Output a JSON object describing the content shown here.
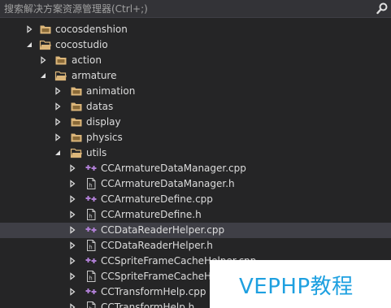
{
  "search": {
    "placeholder": "搜索解决方案资源管理器(Ctrl+;)"
  },
  "tree": {
    "items": [
      {
        "label": "cocosdenshion",
        "type": "folder",
        "level": 2,
        "expanded": false
      },
      {
        "label": "cocostudio",
        "type": "folder",
        "level": 2,
        "expanded": true
      },
      {
        "label": "action",
        "type": "folder",
        "level": 3,
        "expanded": false
      },
      {
        "label": "armature",
        "type": "folder",
        "level": 3,
        "expanded": true
      },
      {
        "label": "animation",
        "type": "folder",
        "level": 4,
        "expanded": false
      },
      {
        "label": "datas",
        "type": "folder",
        "level": 4,
        "expanded": false
      },
      {
        "label": "display",
        "type": "folder",
        "level": 4,
        "expanded": false
      },
      {
        "label": "physics",
        "type": "folder",
        "level": 4,
        "expanded": false
      },
      {
        "label": "utils",
        "type": "folder",
        "level": 4,
        "expanded": true
      },
      {
        "label": "CCArmatureDataManager.cpp",
        "type": "cpp",
        "level": 5,
        "expanded": false
      },
      {
        "label": "CCArmatureDataManager.h",
        "type": "h",
        "level": 5,
        "expanded": false
      },
      {
        "label": "CCArmatureDefine.cpp",
        "type": "cpp",
        "level": 5,
        "expanded": false
      },
      {
        "label": "CCArmatureDefine.h",
        "type": "h",
        "level": 5,
        "expanded": false
      },
      {
        "label": "CCDataReaderHelper.cpp",
        "type": "cpp",
        "level": 5,
        "expanded": false,
        "selected": true
      },
      {
        "label": "CCDataReaderHelper.h",
        "type": "h",
        "level": 5,
        "expanded": false
      },
      {
        "label": "CCSpriteFrameCacheHelper.cpp",
        "type": "cpp",
        "level": 5,
        "expanded": false
      },
      {
        "label": "CCSpriteFrameCacheHelper.h",
        "type": "h",
        "level": 5,
        "expanded": false
      },
      {
        "label": "CCTransformHelp.cpp",
        "type": "cpp",
        "level": 5,
        "expanded": false
      },
      {
        "label": "CCTransformHelp.h",
        "type": "h",
        "level": 5,
        "expanded": false
      }
    ]
  },
  "watermark": {
    "text": "VEPHP教程"
  },
  "colors": {
    "background": "#252526",
    "folder": "#dcb67a",
    "cpp_plus": "#b180d7",
    "watermark_text": "#1ea0e0"
  }
}
